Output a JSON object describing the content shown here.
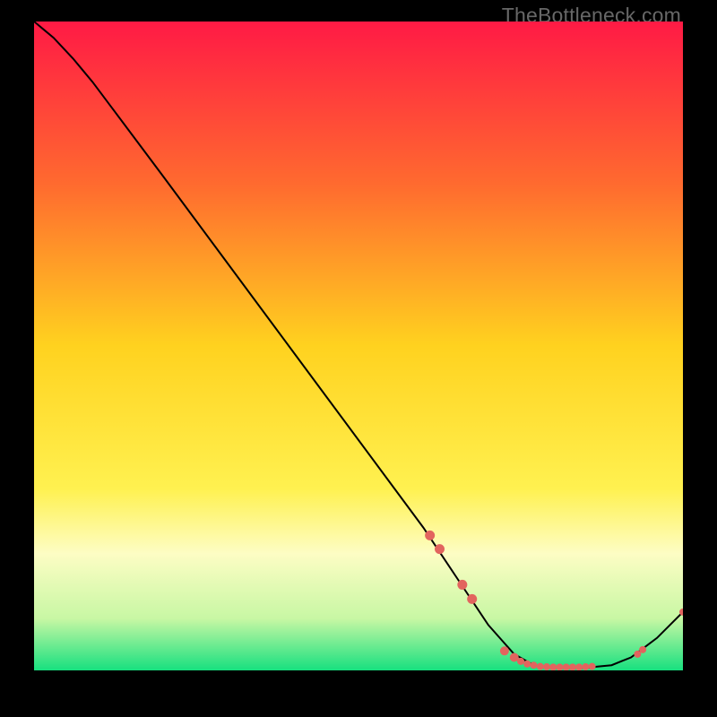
{
  "watermark": "TheBottleneck.com",
  "chart_data": {
    "type": "line",
    "title": "",
    "xlabel": "",
    "ylabel": "",
    "xlim": [
      0,
      100
    ],
    "ylim": [
      0,
      100
    ],
    "grid": false,
    "legend": false,
    "gradient_stops": [
      {
        "offset": 0,
        "color": "#ff1a45"
      },
      {
        "offset": 0.25,
        "color": "#ff6a2f"
      },
      {
        "offset": 0.5,
        "color": "#ffd21f"
      },
      {
        "offset": 0.72,
        "color": "#fff150"
      },
      {
        "offset": 0.82,
        "color": "#fdfdc4"
      },
      {
        "offset": 0.92,
        "color": "#c8f7a4"
      },
      {
        "offset": 1.0,
        "color": "#17e07f"
      }
    ],
    "curve": [
      {
        "x": 0,
        "y": 100
      },
      {
        "x": 3,
        "y": 97.5
      },
      {
        "x": 6,
        "y": 94.3
      },
      {
        "x": 9,
        "y": 90.7
      },
      {
        "x": 12,
        "y": 86.7
      },
      {
        "x": 20,
        "y": 76
      },
      {
        "x": 30,
        "y": 62.5
      },
      {
        "x": 40,
        "y": 49
      },
      {
        "x": 50,
        "y": 35.5
      },
      {
        "x": 60,
        "y": 22
      },
      {
        "x": 66,
        "y": 13
      },
      {
        "x": 70,
        "y": 7
      },
      {
        "x": 74,
        "y": 2.5
      },
      {
        "x": 77,
        "y": 0.8
      },
      {
        "x": 80,
        "y": 0.4
      },
      {
        "x": 85,
        "y": 0.4
      },
      {
        "x": 89,
        "y": 0.8
      },
      {
        "x": 92,
        "y": 2
      },
      {
        "x": 96,
        "y": 5
      },
      {
        "x": 100,
        "y": 9
      }
    ],
    "markers": [
      {
        "x": 61,
        "y": 20.8,
        "r": 5.5
      },
      {
        "x": 62.5,
        "y": 18.7,
        "r": 5.5
      },
      {
        "x": 66,
        "y": 13.2,
        "r": 5.5
      },
      {
        "x": 67.5,
        "y": 11,
        "r": 5.5
      },
      {
        "x": 72.5,
        "y": 3,
        "r": 5
      },
      {
        "x": 74,
        "y": 2,
        "r": 5
      },
      {
        "x": 75,
        "y": 1.4,
        "r": 4
      },
      {
        "x": 76,
        "y": 1,
        "r": 4
      },
      {
        "x": 77,
        "y": 0.8,
        "r": 4
      },
      {
        "x": 78,
        "y": 0.6,
        "r": 4
      },
      {
        "x": 79,
        "y": 0.55,
        "r": 4
      },
      {
        "x": 80,
        "y": 0.5,
        "r": 4
      },
      {
        "x": 81,
        "y": 0.5,
        "r": 4
      },
      {
        "x": 82,
        "y": 0.5,
        "r": 4
      },
      {
        "x": 83,
        "y": 0.5,
        "r": 4
      },
      {
        "x": 84,
        "y": 0.5,
        "r": 4
      },
      {
        "x": 85,
        "y": 0.55,
        "r": 4
      },
      {
        "x": 86,
        "y": 0.6,
        "r": 4
      },
      {
        "x": 93,
        "y": 2.5,
        "r": 4
      },
      {
        "x": 93.8,
        "y": 3.2,
        "r": 4
      },
      {
        "x": 100,
        "y": 9,
        "r": 4
      }
    ],
    "marker_color": "#e2645e",
    "curve_color": "#000000"
  }
}
